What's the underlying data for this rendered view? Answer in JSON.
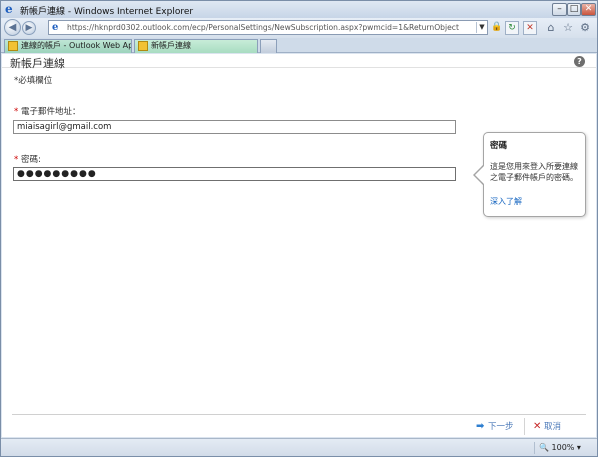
{
  "window": {
    "title": "新帳戶連線 - Windows Internet Explorer",
    "controls": {
      "minimize": "–",
      "maximize": "□",
      "close": "✕"
    }
  },
  "navbar": {
    "url": "https://hknprd0302.outlook.com/ecp/PersonalSettings/NewSubscription.aspx?pwmcid=1&ReturnObjectType=1",
    "icons": [
      "back-icon",
      "forward-icon",
      "page-icon",
      "lock-icon",
      "refresh-icon",
      "stop-icon",
      "home-icon",
      "favorites-star-icon",
      "tools-gear-icon"
    ]
  },
  "tabs": [
    {
      "label": "連線的帳戶 - Outlook Web App"
    },
    {
      "label": "新帳戶連線"
    }
  ],
  "page": {
    "title": "新帳戶連線",
    "required_note": "*必填欄位",
    "email_label_star": "* ",
    "email_label": "電子郵件地址：",
    "email_value": "miaisagirl@gmail.com",
    "password_label_star": "* ",
    "password_label": "密碼:",
    "password_value": "●●●●●●●●●"
  },
  "callout": {
    "title": "密碼",
    "body": "這是您用來登入所要連線之電子郵件帳戶的密碼。",
    "link": "深入了解"
  },
  "actions": {
    "next_label": "下一步",
    "cancel_label": "取消"
  },
  "status": {
    "zoom": "100%"
  },
  "colors": {
    "link": "#1565c0",
    "required_star": "#cc0000",
    "cancel_icon": "#c62828",
    "next_icon": "#2f7fd0"
  }
}
